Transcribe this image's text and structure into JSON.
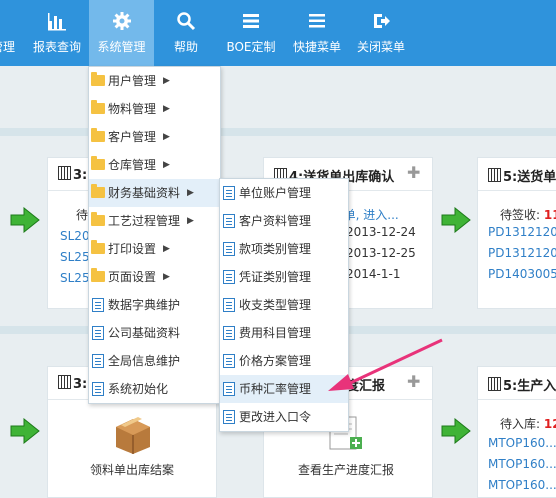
{
  "nav": [
    {
      "label": "管理"
    },
    {
      "label": "报表查询",
      "icon": "bar-chart-icon"
    },
    {
      "label": "系统管理",
      "icon": "gear-icon"
    },
    {
      "label": "帮助",
      "icon": "search-icon"
    },
    {
      "label": "BOE定制",
      "icon": "list-icon"
    },
    {
      "label": "快捷菜单",
      "icon": "menu-icon"
    },
    {
      "label": "关闭菜单",
      "icon": "sign-out-icon"
    }
  ],
  "cards": [
    {
      "title": "3:",
      "lines": [
        "待",
        "SL20",
        "SL25",
        "SL25"
      ]
    },
    {
      "title": "4:送货单出库确认",
      "lines": [
        "0单, 进入...",
        "2013-12-24",
        "2013-12-25",
        "2014-1-1"
      ]
    },
    {
      "title": "5:送货单",
      "lines": [
        "待签收: 11",
        "PD1312120",
        "PD1312120",
        "PD1403005"
      ]
    },
    {
      "title": "3:",
      "caption": "领料单出库结案"
    },
    {
      "title": "度汇报",
      "caption": "查看生产进度汇报"
    },
    {
      "title": "5:生产入",
      "lines": [
        "待入库: 12",
        "MTOP160...",
        "MTOP160...",
        "MTOP160..."
      ]
    }
  ],
  "system_menu": [
    {
      "label": "用户管理",
      "submenu": true
    },
    {
      "label": "物料管理",
      "submenu": true
    },
    {
      "label": "客户管理",
      "submenu": true
    },
    {
      "label": "仓库管理",
      "submenu": true
    },
    {
      "label": "财务基础资料",
      "submenu": true
    },
    {
      "label": "工艺过程管理",
      "submenu": true
    },
    {
      "label": "打印设置",
      "submenu": true
    },
    {
      "label": "页面设置",
      "submenu": true
    },
    {
      "label": "数据字典维护",
      "submenu": false
    },
    {
      "label": "公司基础资料",
      "submenu": false
    },
    {
      "label": "全局信息维护",
      "submenu": false
    },
    {
      "label": "系统初始化",
      "submenu": false
    }
  ],
  "finance_submenu": [
    {
      "label": "单位账户管理"
    },
    {
      "label": "客户资料管理"
    },
    {
      "label": "款项类别管理"
    },
    {
      "label": "凭证类别管理"
    },
    {
      "label": "收支类型管理"
    },
    {
      "label": "费用科目管理"
    },
    {
      "label": "价格方案管理"
    },
    {
      "label": "币种汇率管理"
    },
    {
      "label": "更改进入口令"
    }
  ],
  "colors": {
    "topbar": "#2f93dc",
    "active_nav": "#73b9eb",
    "annotation_arrow": "#e8337a",
    "link": "#2f7fc7"
  }
}
